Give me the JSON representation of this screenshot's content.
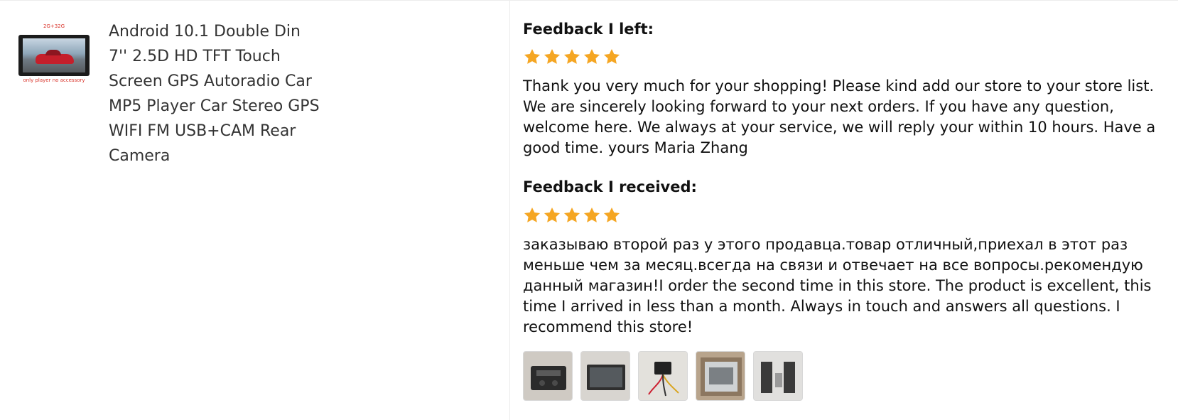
{
  "product": {
    "thumb_top_label": "2G+32G",
    "thumb_bottom_label": "only player no accessory",
    "title": "Android 10.1 Double Din 7'' 2.5D HD TFT Touch Screen GPS Autoradio Car MP5 Player Car Stereo GPS WIFI FM USB+CAM Rear Camera"
  },
  "feedback_left": {
    "heading": "Feedback I left:",
    "rating": 5,
    "text": "Thank you very much for your shopping! Please kind add our store to your store list. We are sincerely looking forward to your next orders. If you have any question, welcome here. We always at your service, we will reply your within 10 hours. Have a good time. yours Maria Zhang"
  },
  "feedback_received": {
    "heading": "Feedback I received:",
    "rating": 5,
    "text": "заказываю второй раз у этого продавца.товар отличный,приехал в этот раз меньше чем за месяц.всегда на связи и отвечает на все вопросы.рекомендую данный магазин!I order the second time in this store. The product is excellent, this time I arrived in less than a month. Always in touch and answers all questions. I recommend this store!",
    "photo_count": 5
  },
  "colors": {
    "star": "#f5a623",
    "label_red": "#d9342b",
    "text": "#111111"
  }
}
